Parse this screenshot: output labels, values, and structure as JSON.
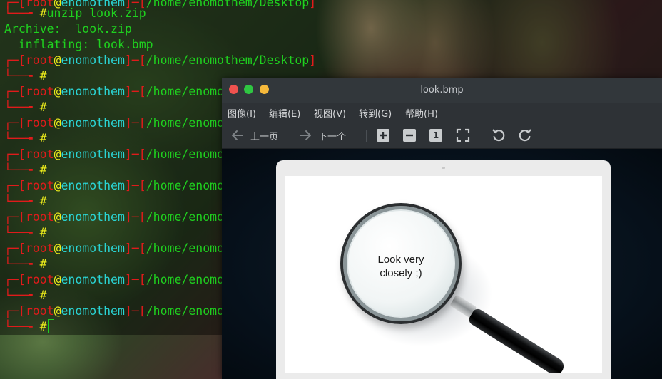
{
  "terminal": {
    "line0": {
      "user": "root",
      "at": "@",
      "host": "enomothem",
      "path": "/home/enomothem/Desktop"
    },
    "line1": {
      "hash": "#",
      "command": "unzip look.zip"
    },
    "line2": "Archive:  look.zip",
    "line3": "  inflating: look.bmp",
    "prompts": [
      {
        "user": "root",
        "at": "@",
        "host": "enomothem",
        "path": "/home/enomothem/Desktop",
        "hash": "#"
      },
      {
        "user": "root",
        "at": "@",
        "host": "enomothem",
        "path": "/home/enomothem/Desktop",
        "hash": "#"
      },
      {
        "user": "root",
        "at": "@",
        "host": "enomothem",
        "path": "/home/enomothem/Desktop",
        "hash": "#"
      },
      {
        "user": "root",
        "at": "@",
        "host": "enomothem",
        "path": "/home/enomothem/Desktop",
        "hash": "#"
      },
      {
        "user": "root",
        "at": "@",
        "host": "enomothem",
        "path": "/home/enomothem/Desktop",
        "hash": "#"
      },
      {
        "user": "root",
        "at": "@",
        "host": "enomothem",
        "path": "/home/enomothem/Desktop",
        "hash": "#"
      },
      {
        "user": "root",
        "at": "@",
        "host": "enomothem",
        "path": "/home/enomothem/Desktop",
        "hash": "#"
      },
      {
        "user": "root",
        "at": "@",
        "host": "enomothem",
        "path": "/home/enomothem/Desktop",
        "hash": "#"
      },
      {
        "user": "root",
        "at": "@",
        "host": "enomothem",
        "path": "/home/enomothem/Desktop",
        "hash": "#"
      }
    ]
  },
  "viewer": {
    "title": "look.bmp",
    "menu": [
      {
        "label": "图像(",
        "key": "I",
        "suffix": ")"
      },
      {
        "label": "编辑(",
        "key": "E",
        "suffix": ")"
      },
      {
        "label": "视图(",
        "key": "V",
        "suffix": ")"
      },
      {
        "label": "转到(",
        "key": "G",
        "suffix": ")"
      },
      {
        "label": "帮助(",
        "key": "H",
        "suffix": ")"
      }
    ],
    "toolbar": {
      "prev_label": "上一页",
      "next_label": "下一个",
      "original_size_label": "1"
    },
    "image_text": [
      "Look very",
      "closely ;)"
    ]
  },
  "colors": {
    "red": "#e01b1b",
    "green": "#1fd11f",
    "yellow": "#e8e81b",
    "cyan": "#2ad4d4",
    "close": "#f0524f",
    "maximize": "#2fc642",
    "minimize": "#f6b93b"
  },
  "icons": [
    "arrow-left-icon",
    "arrow-right-icon",
    "zoom-in-icon",
    "zoom-out-icon",
    "original-size-icon",
    "fit-to-window-icon",
    "rotate-left-icon",
    "rotate-right-icon"
  ]
}
